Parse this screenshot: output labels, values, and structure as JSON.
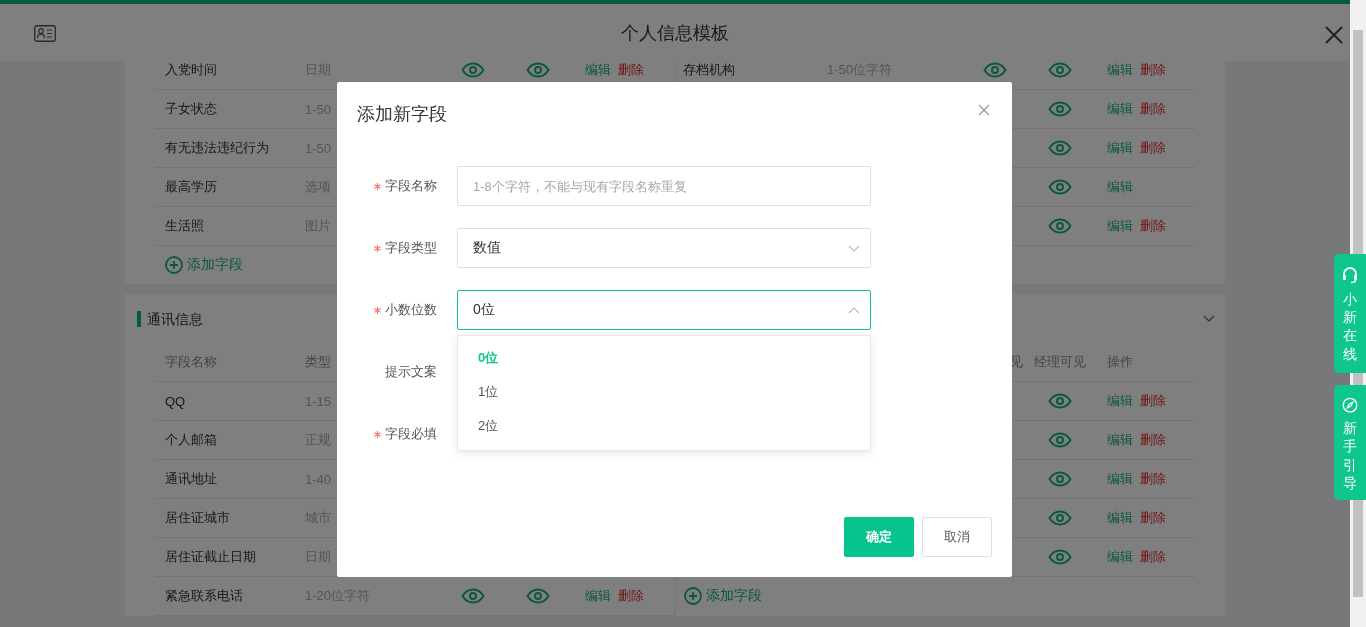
{
  "header": {
    "title": "个人信息模板"
  },
  "sections": [
    {
      "left": {
        "rows": [
          {
            "name": "入党时间",
            "type": "日期",
            "edit": "编辑",
            "delete": "删除"
          },
          {
            "name": "子女状态",
            "type": "1-50"
          },
          {
            "name": "有无违法违纪行为",
            "type": "1-50"
          },
          {
            "name": "最高学历",
            "type": "选项"
          },
          {
            "name": "生活照",
            "type": "图片"
          }
        ],
        "add_label": "添加字段"
      },
      "right": {
        "rows": [
          {
            "name": "存档机构",
            "type": "1-50位字符",
            "edit": "编辑",
            "delete": "删除"
          },
          {
            "edit": "编辑",
            "delete": "删除"
          },
          {
            "edit": "编辑",
            "delete": "删除"
          },
          {
            "edit": "编辑"
          },
          {
            "edit": "编辑",
            "delete": "删除"
          }
        ]
      }
    },
    {
      "title": "通讯信息",
      "expanded": true,
      "left": {
        "columns": [
          "字段名称",
          "类型",
          null,
          null,
          null
        ],
        "rows": [
          {
            "name": "QQ",
            "type": "1-15"
          },
          {
            "name": "个人邮箱",
            "type": "正规"
          },
          {
            "name": "通讯地址",
            "type": "1-40"
          },
          {
            "name": "居住证城市",
            "type": "城市"
          },
          {
            "name": "居住证截止日期",
            "type": "日期"
          },
          {
            "name": "紧急联系电话",
            "type": "1-20位字符",
            "edit": "编辑",
            "delete": "删除"
          }
        ]
      },
      "right": {
        "columns": [
          null,
          null,
          "见",
          "经理可见",
          "操作"
        ],
        "rows": [
          {
            "edit": "编辑",
            "delete": "删除"
          },
          {
            "edit": "编辑",
            "delete": "删除"
          },
          {
            "edit": "编辑",
            "delete": "删除"
          },
          {
            "edit": "编辑",
            "delete": "删除"
          },
          {
            "edit": "编辑",
            "delete": "删除"
          }
        ],
        "add_label": "添加字段"
      }
    }
  ],
  "dialog": {
    "title": "添加新字段",
    "fields": [
      {
        "label": "字段名称",
        "required": true,
        "kind": "input",
        "placeholder": "1-8个字符，不能与现有字段名称重复"
      },
      {
        "label": "字段类型",
        "required": true,
        "kind": "select",
        "value": "数值",
        "open": false
      },
      {
        "label": "小数位数",
        "required": true,
        "kind": "select",
        "value": "0位",
        "open": true,
        "options": [
          {
            "label": "0位",
            "selected": true
          },
          {
            "label": "1位",
            "selected": false
          },
          {
            "label": "2位",
            "selected": false
          }
        ]
      },
      {
        "label": "提示文案",
        "required": false,
        "kind": "covered"
      },
      {
        "label": "字段必填",
        "required": true,
        "kind": "covered"
      }
    ],
    "buttons": [
      {
        "label": "确定",
        "kind": "primary"
      },
      {
        "label": "取消",
        "kind": "default"
      }
    ]
  },
  "side_tabs": [
    {
      "label": "小新在线",
      "kind": "service"
    },
    {
      "label": "新手引导",
      "kind": "guide"
    }
  ]
}
